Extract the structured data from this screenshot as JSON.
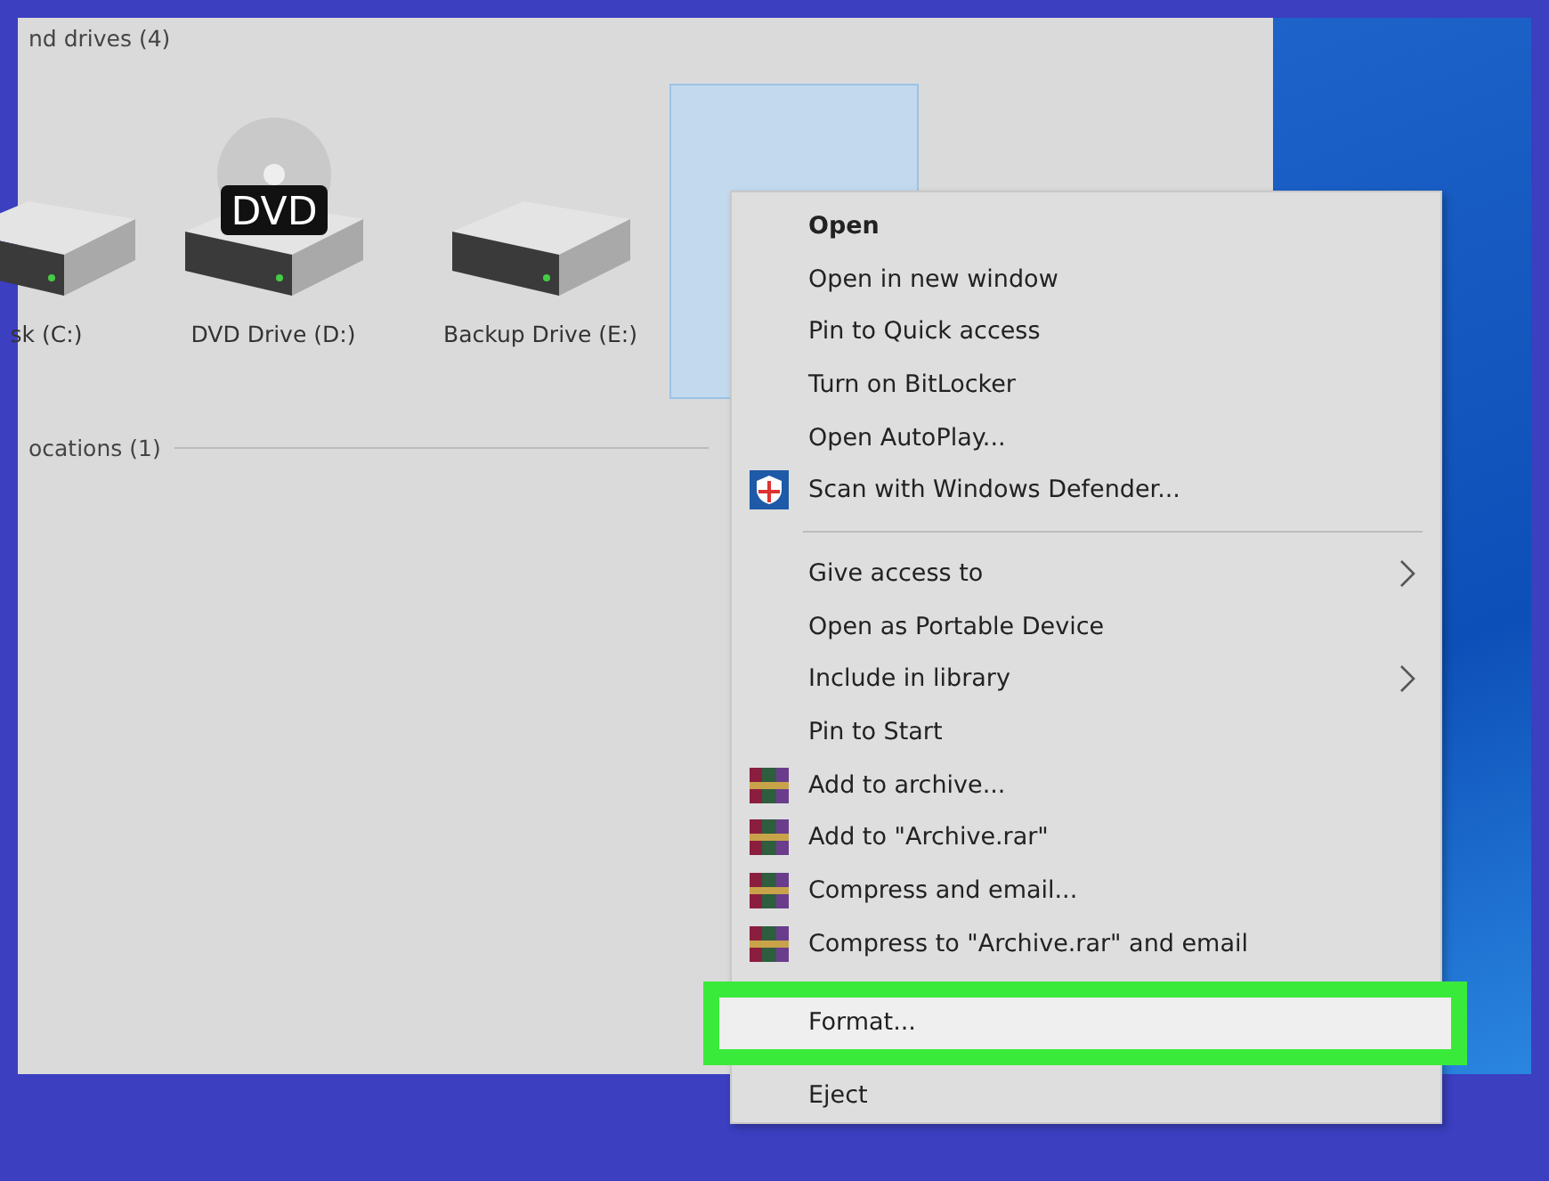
{
  "explorer": {
    "sections": [
      {
        "title": "nd drives (4)",
        "kind": "drives"
      },
      {
        "title": "ocations (1)",
        "kind": "locations"
      }
    ],
    "drives": [
      {
        "label": "sk (C:)",
        "kind": "hdd",
        "selected": false
      },
      {
        "label": "DVD Drive (D:)",
        "kind": "dvd",
        "badge": "DVD",
        "selected": false
      },
      {
        "label": "Backup Drive (E:)",
        "kind": "hdd",
        "selected": false
      },
      {
        "kind": "removable",
        "selected": true
      }
    ]
  },
  "context_menu": {
    "items": [
      {
        "label": "Open",
        "kind": "default",
        "submenu": false,
        "highlighted": false
      },
      {
        "label": "Open in new window",
        "kind": "plain",
        "submenu": false,
        "highlighted": false
      },
      {
        "label": "Pin to Quick access",
        "kind": "plain",
        "submenu": false,
        "highlighted": false
      },
      {
        "label": "Turn on BitLocker",
        "kind": "plain",
        "submenu": false,
        "highlighted": false
      },
      {
        "label": "Open AutoPlay...",
        "kind": "plain",
        "submenu": false,
        "highlighted": false
      },
      {
        "label": "Scan with Windows Defender...",
        "kind": "defender",
        "submenu": false,
        "highlighted": false
      },
      {
        "kind": "separator"
      },
      {
        "label": "Give access to",
        "kind": "plain",
        "submenu": true,
        "highlighted": false
      },
      {
        "label": "Open as Portable Device",
        "kind": "plain",
        "submenu": false,
        "highlighted": false
      },
      {
        "label": "Include in library",
        "kind": "plain",
        "submenu": true,
        "highlighted": false
      },
      {
        "label": "Pin to Start",
        "kind": "plain",
        "submenu": false,
        "highlighted": false
      },
      {
        "label": "Add to archive...",
        "kind": "archive",
        "submenu": false,
        "highlighted": false
      },
      {
        "label": "Add to \"Archive.rar\"",
        "kind": "archive",
        "submenu": false,
        "highlighted": false
      },
      {
        "label": "Compress and email...",
        "kind": "archive",
        "submenu": false,
        "highlighted": false
      },
      {
        "label": "Compress to \"Archive.rar\" and email",
        "kind": "archive",
        "submenu": false,
        "highlighted": false
      },
      {
        "label": "Format...",
        "kind": "plain",
        "submenu": false,
        "highlighted": true
      },
      {
        "label": "Eject",
        "kind": "plain",
        "submenu": false,
        "highlighted": false
      }
    ]
  }
}
